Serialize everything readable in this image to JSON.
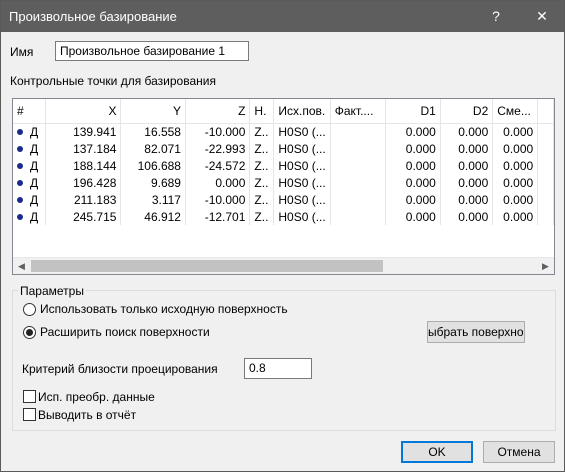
{
  "window": {
    "title": "Произвольное базирование",
    "help_glyph": "?",
    "close_glyph": "✕"
  },
  "name_field": {
    "label": "Имя",
    "value": "Произвольное базирование 1"
  },
  "points_section": {
    "label": "Контрольные точки для базирования",
    "columns": [
      "#",
      "X",
      "Y",
      "Z",
      "Н.",
      "Исх.пов.",
      "Факт....",
      "D1",
      "D2",
      "Сме..."
    ],
    "rows": [
      [
        "Д",
        "139.941",
        "16.558",
        "-10.000",
        "Z..",
        "H0S0 (...",
        "",
        "0.000",
        "0.000",
        "0.000"
      ],
      [
        "Д",
        "137.184",
        "82.071",
        "-22.993",
        "Z..",
        "H0S0 (...",
        "",
        "0.000",
        "0.000",
        "0.000"
      ],
      [
        "Д",
        "188.144",
        "106.688",
        "-24.572",
        "Z..",
        "H0S0 (...",
        "",
        "0.000",
        "0.000",
        "0.000"
      ],
      [
        "Д",
        "196.428",
        "9.689",
        "0.000",
        "Z..",
        "H0S0 (...",
        "",
        "0.000",
        "0.000",
        "0.000"
      ],
      [
        "Д",
        "211.183",
        "3.117",
        "-10.000",
        "Z..",
        "H0S0 (...",
        "",
        "0.000",
        "0.000",
        "0.000"
      ],
      [
        "Д",
        "245.715",
        "46.912",
        "-12.701",
        "Z..",
        "H0S0 (...",
        "",
        "0.000",
        "0.000",
        "0.000"
      ]
    ],
    "scroll_left_glyph": "◀",
    "scroll_right_glyph": "▶"
  },
  "parameters": {
    "label": "Параметры",
    "radio_source_only": "Использовать только исходную поверхность",
    "radio_extend_search": "Расширить поиск поверхности",
    "selected_radio": "extend_search",
    "select_surface_button": "ыбрать поверхност",
    "projection_label": "Критерий близости проецирования",
    "projection_value": "0.8",
    "check_transformed": "Исп. преобр. данные",
    "check_transformed_checked": false,
    "check_report": "Выводить в отчёт",
    "check_report_checked": false
  },
  "footer": {
    "ok": "OK",
    "cancel": "Отмена"
  }
}
